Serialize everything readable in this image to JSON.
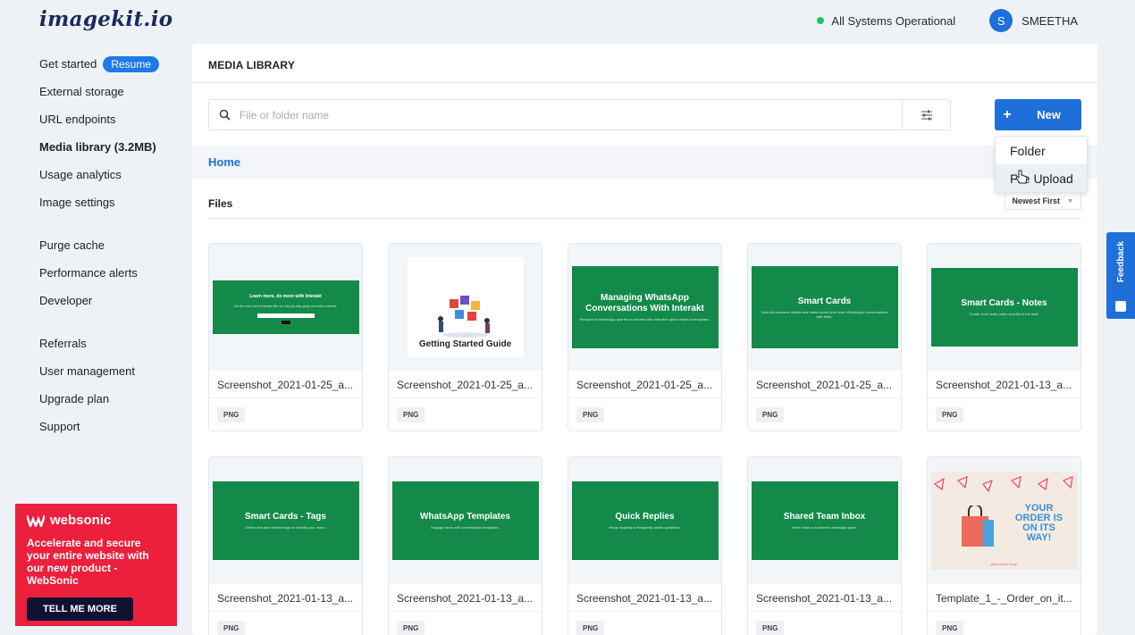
{
  "app": {
    "logo": "imagekit.io",
    "status_text": "All Systems Operational",
    "status_color": "#22c55e",
    "user_initial": "S",
    "user_name": "SMEETHA"
  },
  "sidebar": {
    "items": [
      {
        "label": "Get started",
        "badge": "Resume"
      },
      {
        "label": "External storage"
      },
      {
        "label": "URL endpoints"
      },
      {
        "label": "Media library (3.2MB)",
        "active": true
      },
      {
        "label": "Usage analytics"
      },
      {
        "label": "Image settings"
      },
      {
        "label": "Purge cache"
      },
      {
        "label": "Performance alerts"
      },
      {
        "label": "Developer"
      },
      {
        "label": "Referrals"
      },
      {
        "label": "User management"
      },
      {
        "label": "Upgrade plan"
      },
      {
        "label": "Support"
      }
    ]
  },
  "promo": {
    "brand": "websonic",
    "text": "Accelerate and secure your entire website with our new product - WebSonic",
    "button": "TELL ME MORE",
    "bg_color": "#ec1f3d"
  },
  "main": {
    "title": "MEDIA LIBRARY",
    "search_placeholder": "File or folder name",
    "new_button": "New",
    "new_menu": [
      "Folder",
      "File Upload"
    ],
    "breadcrumb": "Home",
    "files_heading": "Files",
    "sort": "Newest First"
  },
  "files": [
    {
      "name": "Screenshot_2021-01-25_a...",
      "type": "PNG",
      "thumb_title": "Learn more, do more with Interakt",
      "thumb_sub": "Get the most out of Interakt with our step-by-step guide and video tutorials."
    },
    {
      "name": "Screenshot_2021-01-25_a...",
      "type": "PNG",
      "thumb_title": "Getting Started Guide"
    },
    {
      "name": "Screenshot_2021-01-25_a...",
      "type": "PNG",
      "thumb_title": "Managing WhatsApp Conversations With Interakt",
      "thumb_sub": "Respond to WhatsApp queries in minutes with Interakt's quick replies & templates."
    },
    {
      "name": "Screenshot_2021-01-25_a...",
      "type": "PNG",
      "thumb_title": "Smart Cards",
      "thumb_sub": "View full customer details and notes where your team WhatsApps conversations with them."
    },
    {
      "name": "Screenshot_2021-01-13_a...",
      "type": "PNG",
      "thumb_title": "Smart Cards - Notes",
      "thumb_sub": "Create short team notes specific to the lead."
    },
    {
      "name": "Screenshot_2021-01-13_a...",
      "type": "PNG",
      "thumb_title": "Smart Cards - Tags",
      "thumb_sub": "Define and add relevant tags to identify your users."
    },
    {
      "name": "Screenshot_2021-01-13_a...",
      "type": "PNG",
      "thumb_title": "WhatsApp Templates",
      "thumb_sub": "Engage users with conversation templates."
    },
    {
      "name": "Screenshot_2021-01-13_a...",
      "type": "PNG",
      "thumb_title": "Quick Replies",
      "thumb_sub": "Reply instantly to frequently asked questions."
    },
    {
      "name": "Screenshot_2021-01-13_a...",
      "type": "PNG",
      "thumb_title": "Shared Team Inbox",
      "thumb_sub": "Never miss a customer's message again."
    },
    {
      "name": "Template_1_-_Order_on_it...",
      "type": "PNG",
      "thumb_title": "YOUR ORDER IS ON ITS WAY!",
      "thumb_sub": "gift's cutest shop"
    }
  ],
  "feedback": "Feedback"
}
